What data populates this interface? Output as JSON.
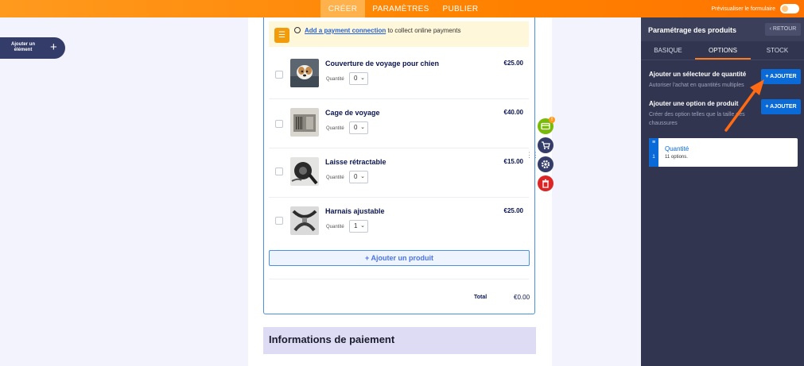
{
  "topbar": {
    "tabs": [
      {
        "label": "CRÉER",
        "active": true
      },
      {
        "label": "PARAMÈTRES",
        "active": false
      },
      {
        "label": "PUBLIER",
        "active": false
      }
    ],
    "preview_label": "Prévisualiser le formulaire"
  },
  "canvas": {
    "add_element_label": "Ajouter un élément",
    "add_element_icon": "plus-icon"
  },
  "form": {
    "notice": {
      "link_text": "Add a payment connection",
      "rest_text": " to collect online payments",
      "icon": "list-icon"
    },
    "quantity_label": "Quantité",
    "products": [
      {
        "name": "Couverture de voyage pour chien",
        "price": "€25.00",
        "quantity": "0"
      },
      {
        "name": "Cage de voyage",
        "price": "€40.00",
        "quantity": "0"
      },
      {
        "name": "Laisse rétractable",
        "price": "€15.00",
        "quantity": "0"
      },
      {
        "name": "Harnais ajustable",
        "price": "€25.00",
        "quantity": "1"
      }
    ],
    "add_product_label": "+ Ajouter un produit",
    "total_label": "Total",
    "total_value": "€0.00",
    "payment_section_title": "Informations de paiement"
  },
  "tools": {
    "badge_count": "!",
    "items": [
      {
        "icon": "credit-card-icon",
        "color": "#78bb07"
      },
      {
        "icon": "cart-icon",
        "color": "#343c6a"
      },
      {
        "icon": "gear-icon",
        "color": "#343c6a"
      },
      {
        "icon": "trash-icon",
        "color": "#dc2626"
      }
    ]
  },
  "panel": {
    "title": "Paramétrage des produits",
    "back_label": "RETOUR",
    "tabs": [
      {
        "label": "BASIQUE",
        "active": false
      },
      {
        "label": "OPTIONS",
        "active": true
      },
      {
        "label": "STOCK",
        "active": false
      }
    ],
    "quantity_selector": {
      "title": "Ajouter un sélecteur de quantité",
      "desc": "Autoriser l'achat en quantités multiples",
      "button": "+ AJOUTER"
    },
    "product_option": {
      "title": "Ajouter une option de produit",
      "desc": "Créer des option telles que la taille des chaussures",
      "button": "+ AJOUTER"
    },
    "quantity_card": {
      "title": "Quantité",
      "sub": "11 options.",
      "index": "1"
    }
  },
  "colors": {
    "accent_orange": "#ff8200",
    "primary_blue": "#0a6bd8",
    "panel_bg": "#31354f",
    "arrow": "#ff6a13"
  }
}
